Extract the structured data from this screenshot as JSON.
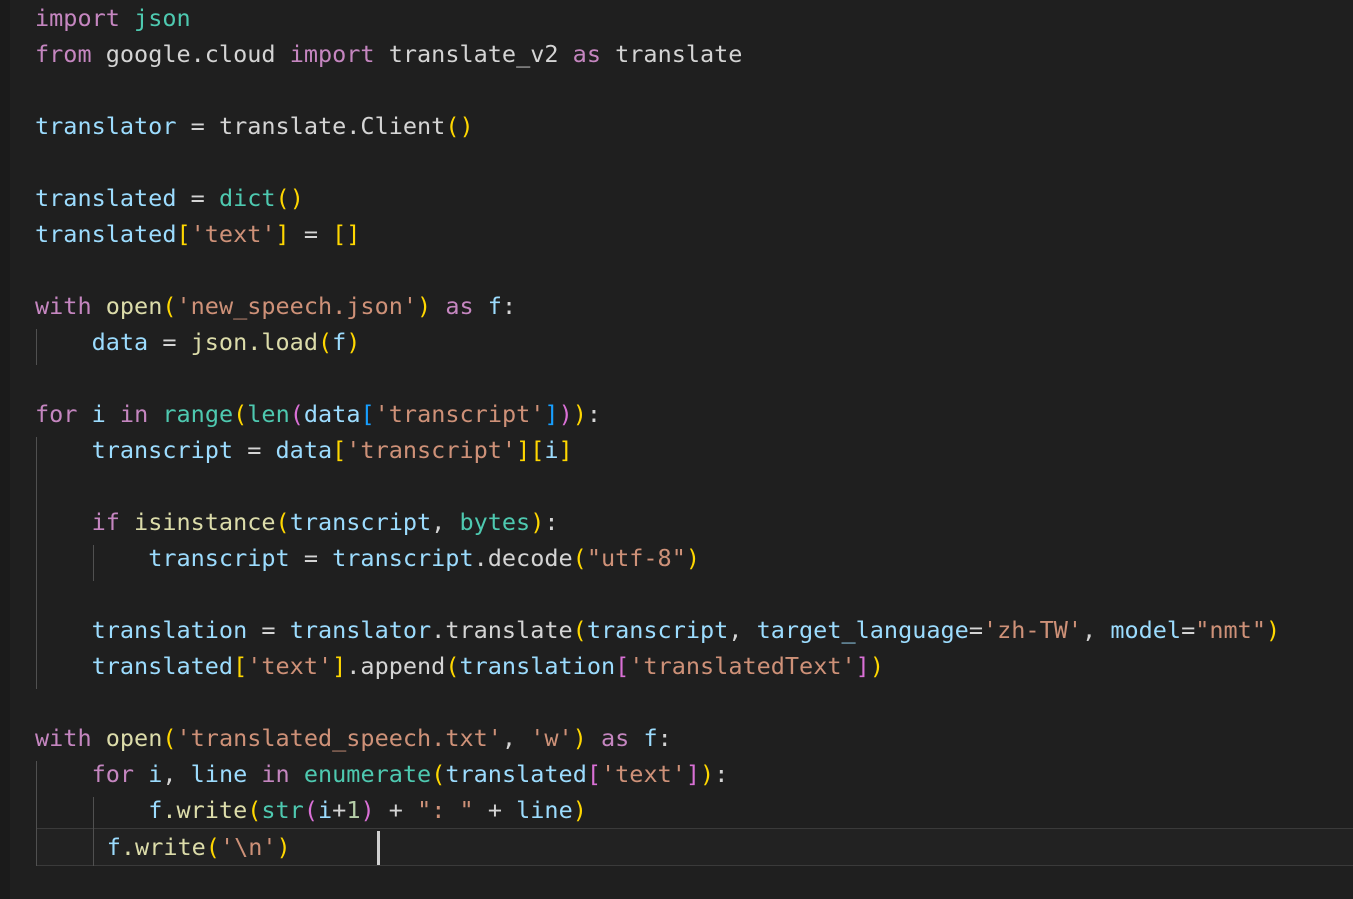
{
  "editor": {
    "language": "python",
    "background_color": "#1f1f1f",
    "current_line_background": "#222222",
    "cursor_color": "#d0d0d0",
    "cursor_line_index": 23,
    "indent_guide_color": "#505050",
    "palette": {
      "keyword": "#c586c0",
      "variable": "#9cdcfe",
      "module": "#d4d4d4",
      "builtin": "#4ec9b0",
      "function": "#dcdcaa",
      "string": "#ce9178",
      "number": "#b5cea8",
      "operator": "#d4d4d4",
      "bracket_depth_1": "#ffd700",
      "bracket_depth_2": "#da70d6",
      "bracket_depth_3": "#179fff"
    }
  },
  "code": {
    "lines": [
      "import json",
      "from google.cloud import translate_v2 as translate",
      "",
      "translator = translate.Client()",
      "",
      "translated = dict()",
      "translated['text'] = []",
      "",
      "with open('new_speech.json') as f:",
      "    data = json.load(f)",
      "",
      "for i in range(len(data['transcript'])):",
      "    transcript = data['transcript'][i]",
      "",
      "    if isinstance(transcript, bytes):",
      "        transcript = transcript.decode(\"utf-8\")",
      "",
      "    translation = translator.translate(transcript, target_language='zh-TW', model=\"nmt\")",
      "    translated['text'].append(translation['translatedText'])",
      "",
      "with open('translated_speech.txt', 'w') as f:",
      "    for i, line in enumerate(translated['text']):",
      "        f.write(str(i+1) + \": \" + line)",
      "        f.write('\\n')"
    ],
    "tokens": {
      "l0": {
        "kw_import": "import",
        "mod_json": "json"
      },
      "l1": {
        "kw_from": "from",
        "mod_google_cloud": "google.cloud",
        "kw_import": "import",
        "mod_translate_v2": "translate_v2",
        "kw_as": "as",
        "mod_translate": "translate"
      },
      "l3": {
        "var_translator": "translator",
        "op_eq": " = ",
        "mod_translate_client": "translate.Client",
        "paren_open": "(",
        "paren_close": ")"
      },
      "l5": {
        "var_translated": "translated",
        "op_eq": " = ",
        "builtin_dict": "dict",
        "paren_open": "(",
        "paren_close": ")"
      },
      "l6": {
        "var_translated": "translated",
        "bracket_open": "[",
        "str_text": "'text'",
        "bracket_close": "]",
        "op_eq": " = ",
        "list_open": "[",
        "list_close": "]"
      },
      "l8": {
        "kw_with": "with",
        "fn_open": "open",
        "paren_open": "(",
        "str_file": "'new_speech.json'",
        "paren_close": ")",
        "kw_as": "as",
        "var_f": "f",
        "colon": ":"
      },
      "l9": {
        "var_data": "data",
        "op_eq": " = ",
        "mod_json_load": "json.load",
        "paren_open": "(",
        "var_f": "f",
        "paren_close": ")"
      },
      "l11": {
        "kw_for": "for",
        "var_i": "i",
        "kw_in": "in",
        "builtin_range": "range",
        "paren1_open": "(",
        "builtin_len": "len",
        "paren2_open": "(",
        "var_data": "data",
        "bracket3_open": "[",
        "str_transcript": "'transcript'",
        "bracket3_close": "]",
        "paren2_close": ")",
        "paren1_close": ")",
        "colon": ":"
      },
      "l12": {
        "var_transcript": "transcript",
        "op_eq": " = ",
        "var_data": "data",
        "bracket1_open": "[",
        "str_transcript": "'transcript'",
        "bracket1_close": "]",
        "bracket2_open": "[",
        "var_i": "i",
        "bracket2_close": "]"
      },
      "l14": {
        "kw_if": "if",
        "fn_isinstance": "isinstance",
        "paren_open": "(",
        "var_transcript": "transcript",
        "comma": ", ",
        "builtin_bytes": "bytes",
        "paren_close": ")",
        "colon": ":"
      },
      "l15": {
        "var_transcript": "transcript",
        "op_eq": " = ",
        "var_transcript2": "transcript",
        "fn_decode": ".decode",
        "paren_open": "(",
        "str_utf8": "\"utf-8\"",
        "paren_close": ")"
      },
      "l17": {
        "var_translation": "translation",
        "op_eq": " = ",
        "var_translator": "translator",
        "fn_translate": ".translate",
        "paren_open": "(",
        "var_transcript": "transcript",
        "comma1": ", ",
        "kwarg_target_language": "target_language",
        "op_eq2": "=",
        "str_zhtw": "'zh-TW'",
        "comma2": ", ",
        "kwarg_model": "model",
        "op_eq3": "=",
        "str_nmt": "\"nmt\"",
        "paren_close": ")"
      },
      "l18": {
        "var_translated": "translated",
        "bracket1_open": "[",
        "str_text": "'text'",
        "bracket1_close": "]",
        "fn_append": ".append",
        "paren_open": "(",
        "var_translation": "translation",
        "bracket2_open": "[",
        "str_translatedtext": "'translatedText'",
        "bracket2_close": "]",
        "paren_close": ")"
      },
      "l20": {
        "kw_with": "with",
        "fn_open": "open",
        "paren_open": "(",
        "str_file": "'translated_speech.txt'",
        "comma": ", ",
        "str_mode": "'w'",
        "paren_close": ")",
        "kw_as": "as",
        "var_f": "f",
        "colon": ":"
      },
      "l21": {
        "kw_for": "for",
        "var_i": "i",
        "comma1": ", ",
        "var_line": "line",
        "kw_in": "in",
        "builtin_enumerate": "enumerate",
        "paren_open": "(",
        "var_translated": "translated",
        "bracket_open": "[",
        "str_text": "'text'",
        "bracket_close": "]",
        "paren_close": ")",
        "colon": ":"
      },
      "l22": {
        "var_f": "f",
        "fn_write": ".write",
        "paren1_open": "(",
        "builtin_str": "str",
        "paren2_open": "(",
        "var_i": "i",
        "op_plus": "+",
        "num_1": "1",
        "paren2_close": ")",
        "op_concat1": " + ",
        "str_sep": "\": \"",
        "op_concat2": " + ",
        "var_line": "line",
        "paren1_close": ")"
      },
      "l23": {
        "var_f": "f",
        "fn_write": ".write",
        "paren_open": "(",
        "str_newline": "'\\n'",
        "paren_close": ")"
      }
    }
  }
}
